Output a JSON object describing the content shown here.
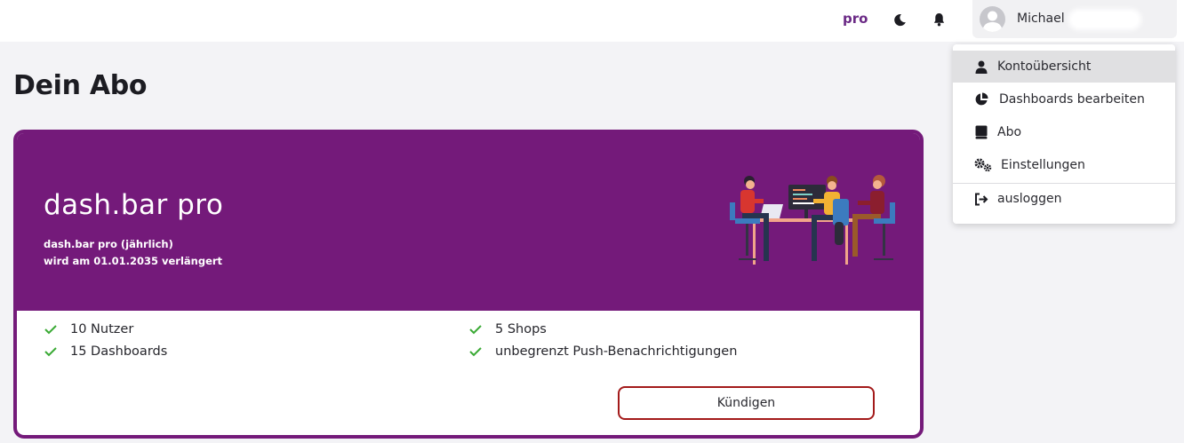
{
  "header": {
    "pro_label": "pro",
    "user_name": "Michael",
    "accent": "#6b2a86"
  },
  "page": {
    "title": "Dein Abo"
  },
  "subscription": {
    "plan_title": "dash.bar pro",
    "plan_billing": "dash.bar pro (jährlich)",
    "renewal_text": "wird am 01.01.2035 verlängert",
    "header_color": "#741a7a",
    "features": [
      {
        "label": "10 Nutzer",
        "icon": "check-icon"
      },
      {
        "label": "15 Dashboards",
        "icon": "check-icon"
      },
      {
        "label": "5 Shops",
        "icon": "check-icon"
      },
      {
        "label": "unbegrenzt Push-Benachrichtigungen",
        "icon": "check-icon"
      }
    ],
    "cancel_label": "Kündigen",
    "cancel_color": "#a31a1a",
    "check_color": "#3aaa35"
  },
  "user_menu": {
    "items": [
      {
        "label": "Kontoübersicht",
        "icon": "user-icon",
        "active": true
      },
      {
        "label": "Dashboards bearbeiten",
        "icon": "pie-chart-icon",
        "active": false
      },
      {
        "label": "Abo",
        "icon": "book-icon",
        "active": false
      },
      {
        "label": "Einstellungen",
        "icon": "gears-icon",
        "active": false
      },
      {
        "label": "ausloggen",
        "icon": "logout-icon",
        "active": false
      }
    ]
  }
}
